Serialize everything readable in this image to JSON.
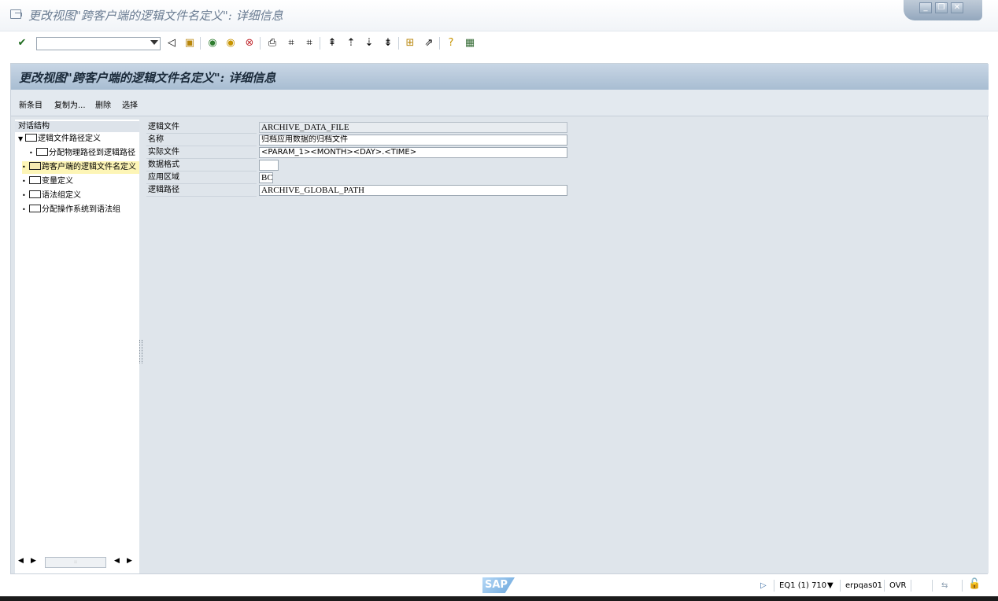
{
  "window": {
    "title": "更改视图\"跨客户端的逻辑文件名定义\": 详细信息",
    "controls": [
      "minimize",
      "restore",
      "close"
    ]
  },
  "toolbar": {
    "command_field": "",
    "buttons": [
      "enter",
      "back-triangle",
      "save",
      "back",
      "exit",
      "cancel",
      "print",
      "find",
      "find-next",
      "first-page",
      "prev-page",
      "next-page",
      "last-page",
      "create-session",
      "shortcut",
      "help",
      "customize"
    ]
  },
  "header": {
    "title": "更改视图\"跨客户端的逻辑文件名定义\": 详细信息"
  },
  "app_toolbar": {
    "new_entries": "新条目",
    "copy_as": "复制为...",
    "delete": "删除",
    "select": "选择"
  },
  "nav": {
    "heading": "对话结构",
    "items": [
      {
        "label": "逻辑文件路径定义"
      },
      {
        "label": "分配物理路径到逻辑路径"
      },
      {
        "label": "跨客户端的逻辑文件名定义"
      },
      {
        "label": "变量定义"
      },
      {
        "label": "语法组定义"
      },
      {
        "label": "分配操作系统到语法组"
      }
    ],
    "scroll_mid": "::"
  },
  "fields": [
    {
      "label": "逻辑文件",
      "value": "ARCHIVE_DATA_FILE"
    },
    {
      "label": "名称",
      "value": "归档应用数据的归档文件"
    },
    {
      "label": "实际文件",
      "value": "<PARAM_1><MONTH><DAY>.<TIME>"
    },
    {
      "label": "数据格式",
      "value": ""
    },
    {
      "label": "应用区域",
      "value": "BC"
    },
    {
      "label": "逻辑路径",
      "value": "ARCHIVE_GLOBAL_PATH"
    }
  ],
  "status": {
    "logo": "SAP",
    "system": "EQ1 (1) 710",
    "server": "erpqas01",
    "mode": "OVR"
  },
  "colors": {
    "header_blue": "#a8bdd2",
    "selected_node": "#fdf5b6",
    "panel_bg": "#dfe5eb"
  }
}
